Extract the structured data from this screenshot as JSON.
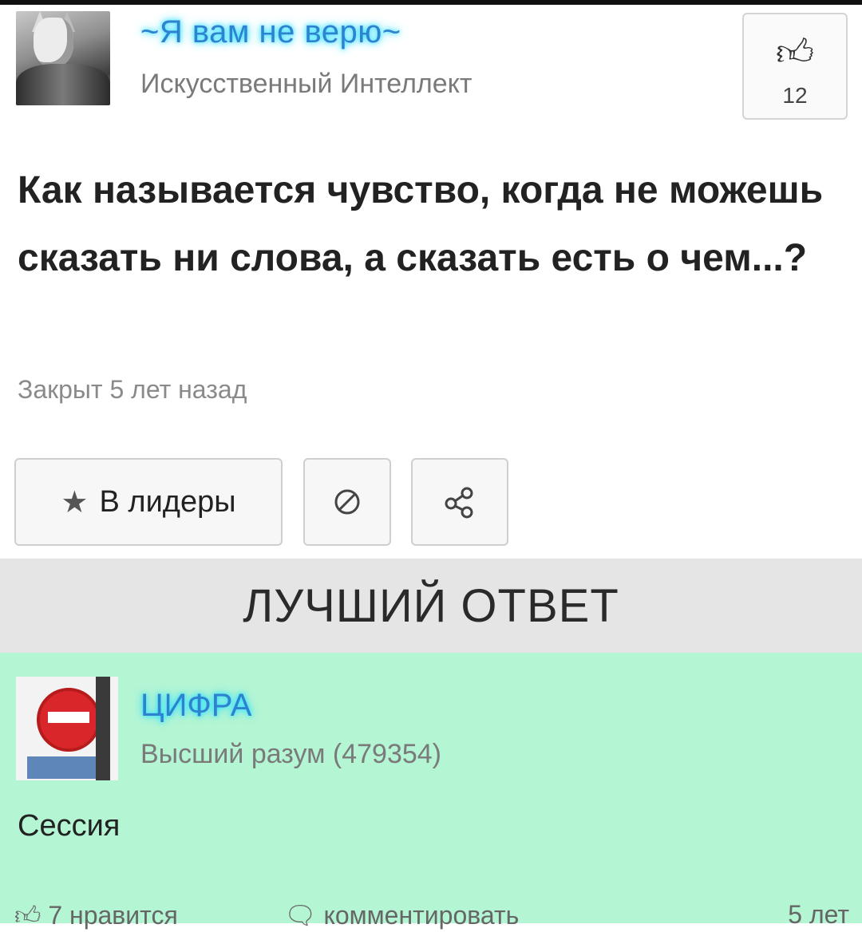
{
  "question": {
    "author": "~Я вам не верю~",
    "rank": "Искусственный Интеллект",
    "likes": "12",
    "text": "Как называется чувство, когда не можешь сказать ни слова, а сказать есть о чем...?",
    "status": "Закрыт 5 лет назад"
  },
  "actions": {
    "leaders_label": "В лидеры",
    "icons": [
      "star-icon",
      "report-icon",
      "share-icon",
      "thumbs-up-icon"
    ]
  },
  "best_answer": {
    "header": "ЛУЧШИЙ ОТВЕТ",
    "author": "ЦИФРА",
    "rank": "Высший разум (479354)",
    "text": "Сессия",
    "likes_text": "7 нравится",
    "comment_label": "комментировать",
    "time": "5 лет"
  },
  "colors": {
    "username": "#2f82d0",
    "answer_bg": "#b4f5d4",
    "header_bg": "#e5e5e5"
  }
}
